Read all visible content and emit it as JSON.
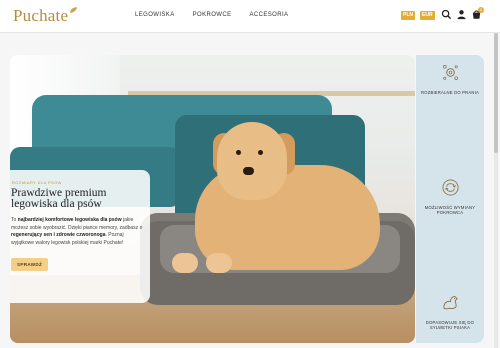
{
  "brand": {
    "logo": "Puchate",
    "accent": "#e3ad33",
    "rail_bg": "#d5e3eb"
  },
  "nav": {
    "items": [
      {
        "label": "LEGOWISKA"
      },
      {
        "label": "POKROWCE"
      },
      {
        "label": "ACCESORIA"
      }
    ]
  },
  "header": {
    "currency": "PLN",
    "language": "EUR",
    "icons": [
      "search-icon",
      "user-icon",
      "cart-icon"
    ],
    "cart_count": "0"
  },
  "hero": {
    "kicker": "ROZMIARY DLA PSOW",
    "title": "Prawdziwe premium legowiska dla psów",
    "desc_parts": [
      "To ",
      "najbardziej komfortowe legowiska dla psów",
      " jakie możesz sobie wyobrazić. Dzięki piance memory, zadbasz o ",
      "regenerujący sen i zdrowie czworonoga",
      ". Poznaj wyjątkowe walory legowisk polskiej marki Puchate!"
    ],
    "cta": "SPRAWDŹ"
  },
  "features": [
    {
      "icon": "wash-icon",
      "label": "ROZBIERALNE DO PRANIA"
    },
    {
      "icon": "cover-swap-icon",
      "label": "MOŻLIWOŚĆ WYMIANY POKROWCA"
    },
    {
      "icon": "dog-fit-icon",
      "label": "DOPASOWUJE SIĘ DO SYLWETKI PSIAKA"
    }
  ]
}
